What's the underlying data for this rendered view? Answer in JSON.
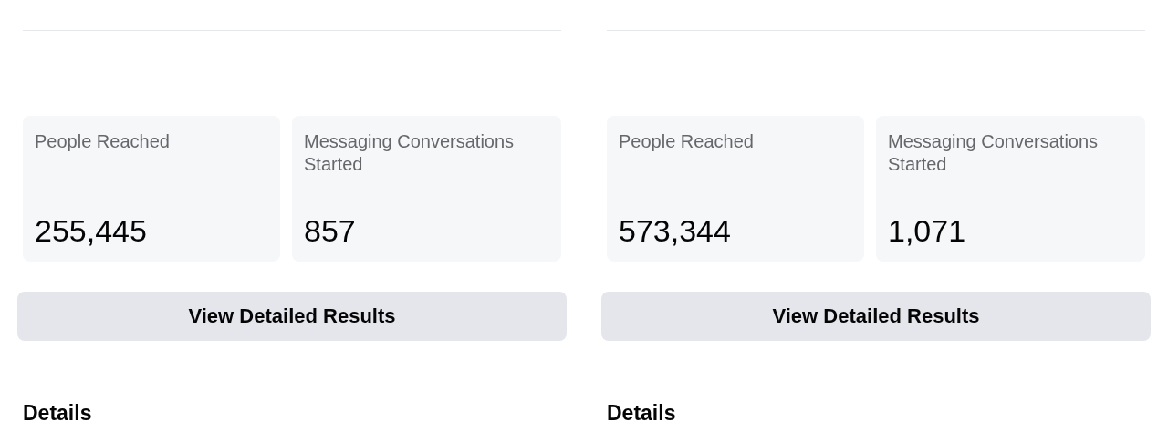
{
  "panels": [
    {
      "metrics": [
        {
          "label": "People Reached",
          "value": "255,445"
        },
        {
          "label": "Messaging Conversations Started",
          "value": "857"
        }
      ],
      "button": "View Detailed Results",
      "section_title": "Details"
    },
    {
      "metrics": [
        {
          "label": "People Reached",
          "value": "573,344"
        },
        {
          "label": "Messaging Conversations Started",
          "value": "1,071"
        }
      ],
      "button": "View Detailed Results",
      "section_title": "Details"
    }
  ]
}
